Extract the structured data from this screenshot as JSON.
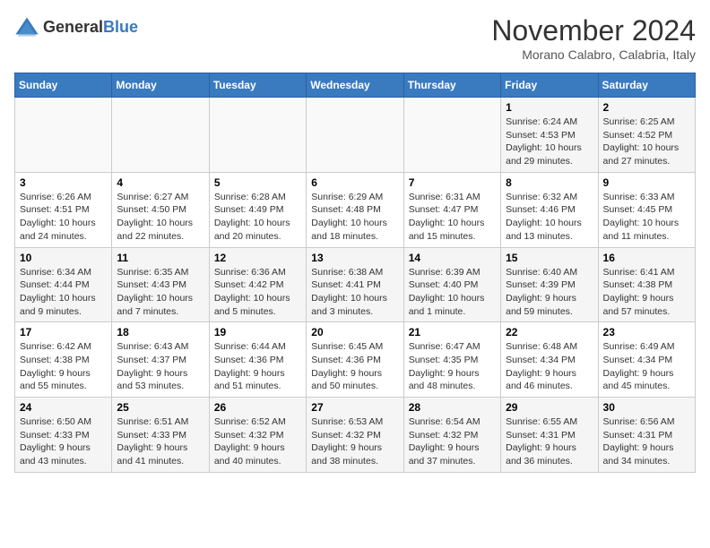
{
  "logo": {
    "general": "General",
    "blue": "Blue"
  },
  "title": "November 2024",
  "location": "Morano Calabro, Calabria, Italy",
  "weekdays": [
    "Sunday",
    "Monday",
    "Tuesday",
    "Wednesday",
    "Thursday",
    "Friday",
    "Saturday"
  ],
  "weeks": [
    [
      {
        "day": "",
        "detail": ""
      },
      {
        "day": "",
        "detail": ""
      },
      {
        "day": "",
        "detail": ""
      },
      {
        "day": "",
        "detail": ""
      },
      {
        "day": "",
        "detail": ""
      },
      {
        "day": "1",
        "detail": "Sunrise: 6:24 AM\nSunset: 4:53 PM\nDaylight: 10 hours and 29 minutes."
      },
      {
        "day": "2",
        "detail": "Sunrise: 6:25 AM\nSunset: 4:52 PM\nDaylight: 10 hours and 27 minutes."
      }
    ],
    [
      {
        "day": "3",
        "detail": "Sunrise: 6:26 AM\nSunset: 4:51 PM\nDaylight: 10 hours and 24 minutes."
      },
      {
        "day": "4",
        "detail": "Sunrise: 6:27 AM\nSunset: 4:50 PM\nDaylight: 10 hours and 22 minutes."
      },
      {
        "day": "5",
        "detail": "Sunrise: 6:28 AM\nSunset: 4:49 PM\nDaylight: 10 hours and 20 minutes."
      },
      {
        "day": "6",
        "detail": "Sunrise: 6:29 AM\nSunset: 4:48 PM\nDaylight: 10 hours and 18 minutes."
      },
      {
        "day": "7",
        "detail": "Sunrise: 6:31 AM\nSunset: 4:47 PM\nDaylight: 10 hours and 15 minutes."
      },
      {
        "day": "8",
        "detail": "Sunrise: 6:32 AM\nSunset: 4:46 PM\nDaylight: 10 hours and 13 minutes."
      },
      {
        "day": "9",
        "detail": "Sunrise: 6:33 AM\nSunset: 4:45 PM\nDaylight: 10 hours and 11 minutes."
      }
    ],
    [
      {
        "day": "10",
        "detail": "Sunrise: 6:34 AM\nSunset: 4:44 PM\nDaylight: 10 hours and 9 minutes."
      },
      {
        "day": "11",
        "detail": "Sunrise: 6:35 AM\nSunset: 4:43 PM\nDaylight: 10 hours and 7 minutes."
      },
      {
        "day": "12",
        "detail": "Sunrise: 6:36 AM\nSunset: 4:42 PM\nDaylight: 10 hours and 5 minutes."
      },
      {
        "day": "13",
        "detail": "Sunrise: 6:38 AM\nSunset: 4:41 PM\nDaylight: 10 hours and 3 minutes."
      },
      {
        "day": "14",
        "detail": "Sunrise: 6:39 AM\nSunset: 4:40 PM\nDaylight: 10 hours and 1 minute."
      },
      {
        "day": "15",
        "detail": "Sunrise: 6:40 AM\nSunset: 4:39 PM\nDaylight: 9 hours and 59 minutes."
      },
      {
        "day": "16",
        "detail": "Sunrise: 6:41 AM\nSunset: 4:38 PM\nDaylight: 9 hours and 57 minutes."
      }
    ],
    [
      {
        "day": "17",
        "detail": "Sunrise: 6:42 AM\nSunset: 4:38 PM\nDaylight: 9 hours and 55 minutes."
      },
      {
        "day": "18",
        "detail": "Sunrise: 6:43 AM\nSunset: 4:37 PM\nDaylight: 9 hours and 53 minutes."
      },
      {
        "day": "19",
        "detail": "Sunrise: 6:44 AM\nSunset: 4:36 PM\nDaylight: 9 hours and 51 minutes."
      },
      {
        "day": "20",
        "detail": "Sunrise: 6:45 AM\nSunset: 4:36 PM\nDaylight: 9 hours and 50 minutes."
      },
      {
        "day": "21",
        "detail": "Sunrise: 6:47 AM\nSunset: 4:35 PM\nDaylight: 9 hours and 48 minutes."
      },
      {
        "day": "22",
        "detail": "Sunrise: 6:48 AM\nSunset: 4:34 PM\nDaylight: 9 hours and 46 minutes."
      },
      {
        "day": "23",
        "detail": "Sunrise: 6:49 AM\nSunset: 4:34 PM\nDaylight: 9 hours and 45 minutes."
      }
    ],
    [
      {
        "day": "24",
        "detail": "Sunrise: 6:50 AM\nSunset: 4:33 PM\nDaylight: 9 hours and 43 minutes."
      },
      {
        "day": "25",
        "detail": "Sunrise: 6:51 AM\nSunset: 4:33 PM\nDaylight: 9 hours and 41 minutes."
      },
      {
        "day": "26",
        "detail": "Sunrise: 6:52 AM\nSunset: 4:32 PM\nDaylight: 9 hours and 40 minutes."
      },
      {
        "day": "27",
        "detail": "Sunrise: 6:53 AM\nSunset: 4:32 PM\nDaylight: 9 hours and 38 minutes."
      },
      {
        "day": "28",
        "detail": "Sunrise: 6:54 AM\nSunset: 4:32 PM\nDaylight: 9 hours and 37 minutes."
      },
      {
        "day": "29",
        "detail": "Sunrise: 6:55 AM\nSunset: 4:31 PM\nDaylight: 9 hours and 36 minutes."
      },
      {
        "day": "30",
        "detail": "Sunrise: 6:56 AM\nSunset: 4:31 PM\nDaylight: 9 hours and 34 minutes."
      }
    ]
  ]
}
